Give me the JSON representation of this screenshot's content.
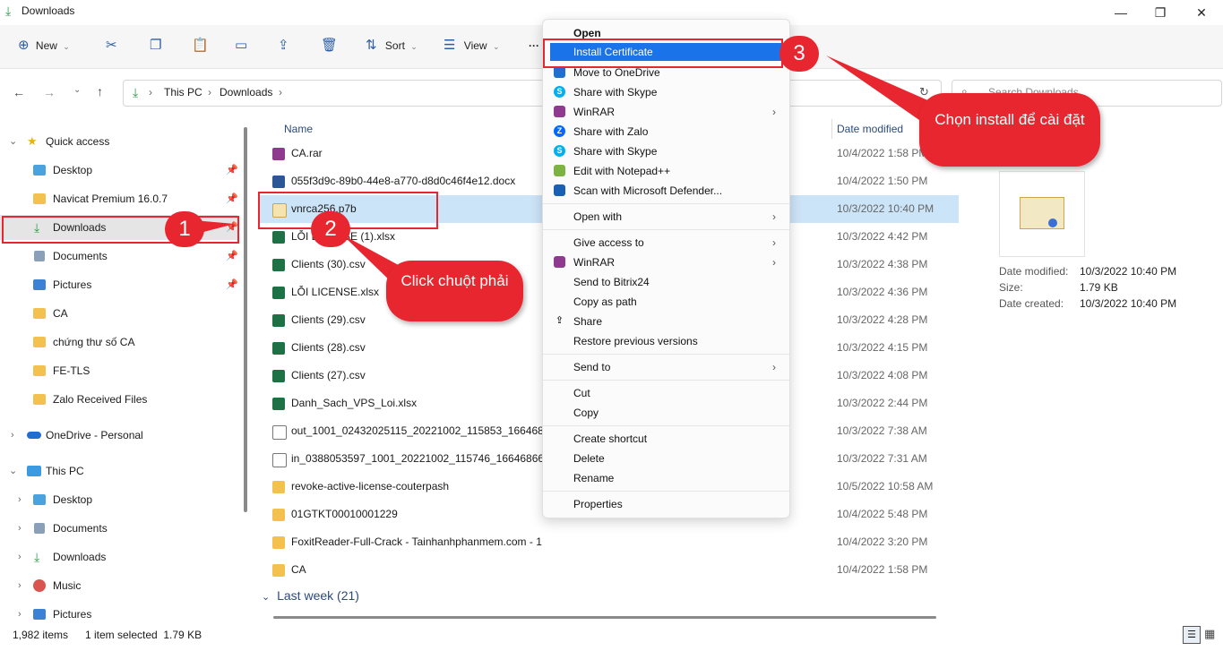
{
  "window": {
    "title": "Downloads",
    "minimize": "—",
    "maximize": "❐",
    "close": "✕"
  },
  "toolbar": {
    "new_label": "New",
    "sort_label": "Sort",
    "view_label": "View",
    "more_label": "···"
  },
  "address": {
    "segments": [
      "This PC",
      "Downloads"
    ],
    "search_placeholder": "Search Downloads"
  },
  "nav": {
    "quick_access": "Quick access",
    "quick_items": [
      {
        "label": "Desktop",
        "icon": "desktop-icon",
        "pinned": true
      },
      {
        "label": "Navicat Premium 16.0.7",
        "icon": "folder-icon",
        "pinned": true
      },
      {
        "label": "Downloads",
        "icon": "download-icon",
        "pinned": true
      },
      {
        "label": "Documents",
        "icon": "documents-icon",
        "pinned": true
      },
      {
        "label": "Pictures",
        "icon": "pictures-icon",
        "pinned": true
      },
      {
        "label": "CA",
        "icon": "folder-icon"
      },
      {
        "label": "chứng thư số CA",
        "icon": "folder-icon"
      },
      {
        "label": "FE-TLS",
        "icon": "folder-icon"
      },
      {
        "label": "Zalo Received Files",
        "icon": "folder-icon"
      }
    ],
    "onedrive": "OneDrive - Personal",
    "this_pc": "This PC",
    "pc_items": [
      {
        "label": "Desktop",
        "icon": "desktop-icon"
      },
      {
        "label": "Documents",
        "icon": "documents-icon"
      },
      {
        "label": "Downloads",
        "icon": "download-icon"
      },
      {
        "label": "Music",
        "icon": "music-icon"
      },
      {
        "label": "Pictures",
        "icon": "pictures-icon"
      }
    ]
  },
  "list": {
    "col_name": "Name",
    "col_date": "Date modified",
    "rows": [
      {
        "name": "CA.rar",
        "date": "10/4/2022 1:58 PM",
        "icon": "winrar-icon"
      },
      {
        "name": "055f3d9c-89b0-44e8-a770-d8d0c46f4e12.docx",
        "date": "10/4/2022 1:50 PM",
        "icon": "word-icon"
      },
      {
        "name": "vnrca256.p7b",
        "date": "10/3/2022 10:40 PM",
        "icon": "certificate-icon",
        "selected": true
      },
      {
        "name": "LỖI LICENSE (1).xlsx",
        "date": "10/3/2022 4:42 PM",
        "icon": "excel-icon"
      },
      {
        "name": "Clients (30).csv",
        "date": "10/3/2022 4:38 PM",
        "icon": "excel-icon"
      },
      {
        "name": "LỖI LICENSE.xlsx",
        "date": "10/3/2022 4:36 PM",
        "icon": "excel-icon"
      },
      {
        "name": "Clients (29).csv",
        "date": "10/3/2022 4:28 PM",
        "icon": "excel-icon"
      },
      {
        "name": "Clients (28).csv",
        "date": "10/3/2022 4:15 PM",
        "icon": "excel-icon"
      },
      {
        "name": "Clients (27).csv",
        "date": "10/3/2022 4:08 PM",
        "icon": "excel-icon"
      },
      {
        "name": "Danh_Sach_VPS_Loi.xlsx",
        "date": "10/3/2022 2:44 PM",
        "icon": "excel-icon"
      },
      {
        "name": "out_1001_02432025115_20221002_115853_1664686733.",
        "date": "10/3/2022 7:38 AM",
        "icon": "media-icon"
      },
      {
        "name": "in_0388053597_1001_20221002_115746_1664686666.22",
        "date": "10/3/2022 7:31 AM",
        "icon": "media-icon"
      },
      {
        "name": "revoke-active-license-couterpash",
        "date": "10/5/2022 10:58 AM",
        "icon": "folder-icon"
      },
      {
        "name": "01GTKT00010001229",
        "date": "10/4/2022 5:48 PM",
        "icon": "folder-icon"
      },
      {
        "name": "FoxitReader-Full-Crack - Tainhanhphanmem.com - 1",
        "date": "10/4/2022 3:20 PM",
        "icon": "folder-icon"
      },
      {
        "name": "CA",
        "date": "10/4/2022 1:58 PM",
        "icon": "folder-icon"
      }
    ],
    "group_last_week": "Last week (21)"
  },
  "context_menu": {
    "items": [
      {
        "label": "Open",
        "bold": true
      },
      {
        "label": "Install Certificate",
        "highlighted": true
      },
      {
        "label": "Move to OneDrive",
        "icon": "onedrive-icon"
      },
      {
        "label": "Share with Skype",
        "icon": "skype-icon"
      },
      {
        "label": "WinRAR",
        "icon": "winrar-icon",
        "submenu": true
      },
      {
        "label": "Share with Zalo",
        "icon": "zalo-icon"
      },
      {
        "label": "Share with Skype",
        "icon": "skype-icon"
      },
      {
        "label": "Edit with Notepad++",
        "icon": "notepadpp-icon"
      },
      {
        "label": "Scan with Microsoft Defender...",
        "icon": "defender-icon"
      },
      {
        "label": "Open with",
        "submenu": true
      },
      {
        "label": "Give access to",
        "submenu": true
      },
      {
        "label": "WinRAR",
        "icon": "winrar-icon",
        "submenu": true
      },
      {
        "label": "Send to Bitrix24"
      },
      {
        "label": "Copy as path"
      },
      {
        "label": "Share",
        "icon": "share-icon"
      },
      {
        "label": "Restore previous versions"
      },
      {
        "label": "Send to",
        "submenu": true
      },
      {
        "label": "Cut"
      },
      {
        "label": "Copy"
      },
      {
        "label": "Create shortcut"
      },
      {
        "label": "Delete"
      },
      {
        "label": "Rename"
      },
      {
        "label": "Properties"
      }
    ]
  },
  "details": {
    "modified_label": "Date modified:",
    "modified_value": "10/3/2022 10:40 PM",
    "size_label": "Size:",
    "size_value": "1.79 KB",
    "created_label": "Date created:",
    "created_value": "10/3/2022 10:40 PM"
  },
  "status": {
    "items_count": "1,982 items",
    "selection": "1 item selected  1.79 KB"
  },
  "annotations": {
    "step1": "1",
    "step2": "2",
    "step3": "3",
    "bubble2": "Click chuột phải",
    "bubble3": "Chọn install để cài đặt"
  },
  "colors": {
    "accent": "#1a73e8",
    "annotation": "#e8262f",
    "selection": "#cce4f7"
  }
}
